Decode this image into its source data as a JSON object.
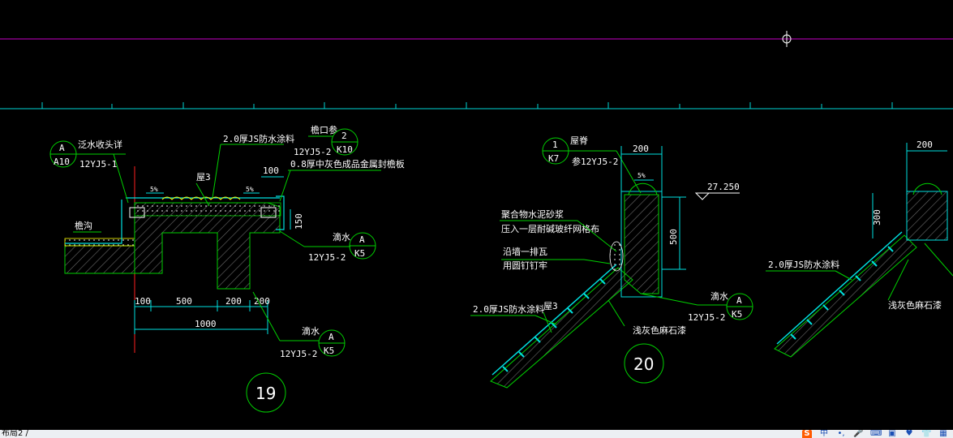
{
  "status_bar": {
    "layout_tab": "布局2 /",
    "tray_icons": [
      "sogou-ime-icon",
      "chinese-mode-icon",
      "punctuation-icon",
      "microphone-icon",
      "keyboard-icon",
      "skin-icon",
      "tools-icon",
      "shirt-icon",
      "grid-icon"
    ],
    "tray_glyphs": [
      "S",
      "中",
      "•,",
      "🎤",
      "⌨",
      "▣",
      "♥",
      "👕",
      "▦"
    ]
  },
  "colors": {
    "background": "#000000",
    "magenta_line": "#c800c8",
    "cyan": "#00e0e0",
    "green": "#00d000",
    "red": "#ff0000",
    "hatch": "#707070",
    "text": "#ffffff",
    "yellow": "#ffff00"
  },
  "detail_19": {
    "number": "19",
    "ref_a10": {
      "letter": "A",
      "sheet": "A10",
      "label": "泛水收头详",
      "std": "12YJ5-1"
    },
    "ref_k10": {
      "letter": "2",
      "sheet": "K10",
      "label": "檐口参",
      "std": "12YJ5-2"
    },
    "ref_k5_right": {
      "letter": "A",
      "sheet": "K5",
      "label": "滴水",
      "std": "12YJ5-2"
    },
    "ref_k5_bottom": {
      "letter": "A",
      "sheet": "K5",
      "label": "滴水",
      "std": "12YJ5-2"
    },
    "coating": "2.0厚JS防水涂料",
    "metal_sheet": "0.8厚中灰色成品金属封檐板",
    "layer": "屋3",
    "gutter": "檐沟",
    "slope_1": "5%",
    "slope_2": "5%",
    "dims": {
      "d100_top": "100",
      "d150": "150",
      "d100": "100",
      "d500": "500",
      "d200a": "200",
      "d200b": "200",
      "d1000": "1000"
    }
  },
  "detail_20": {
    "number": "20",
    "ref_k7": {
      "letter": "1",
      "sheet": "K7",
      "label": "屋脊",
      "std": "参12YJ5-2"
    },
    "ref_k5": {
      "letter": "A",
      "sheet": "K5",
      "label": "滴水",
      "std": "12YJ5-2"
    },
    "mortar_1": "聚合物水泥砂浆",
    "mortar_2": "压入一层耐碱玻纤网格布",
    "tile_1": "沿墙一排瓦",
    "tile_2": "用圆钉钉牢",
    "coating": "2.0厚JS防水涂料",
    "layer": "屋3",
    "stone": "浅灰色麻石漆",
    "elevation": "27.250",
    "slope": "5%",
    "dims": {
      "d200": "200",
      "d500": "500"
    }
  },
  "detail_21": {
    "coating": "2.0厚JS防水涂料",
    "stone": "浅灰色麻石漆",
    "dims": {
      "d200": "200",
      "d300": "300"
    }
  }
}
